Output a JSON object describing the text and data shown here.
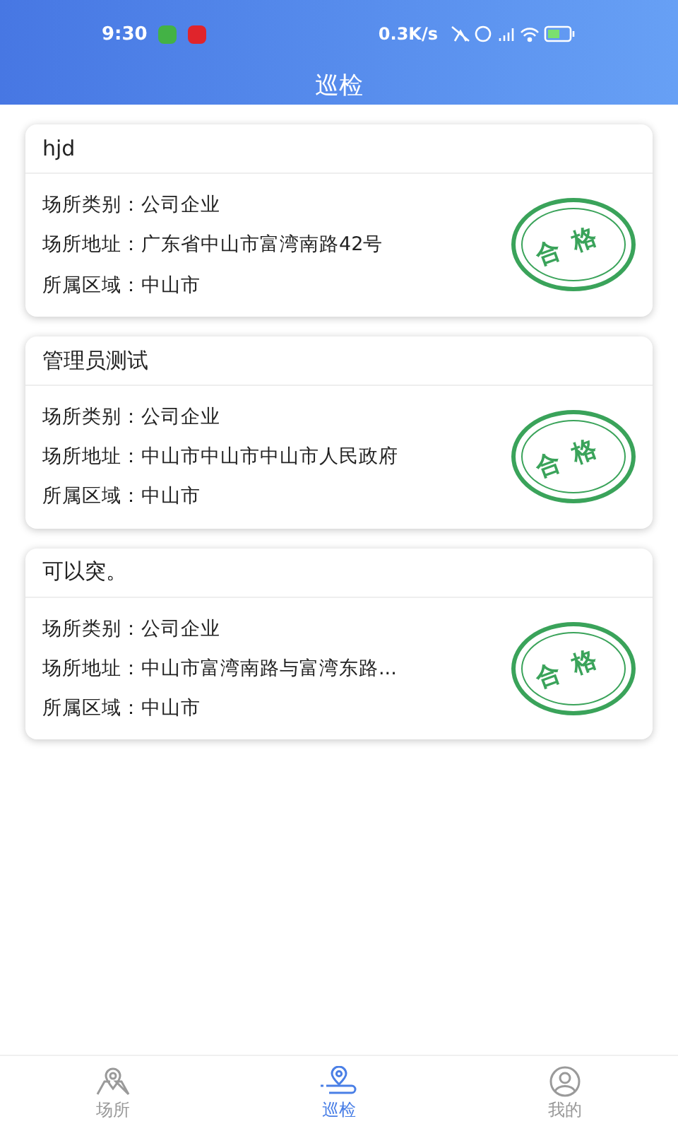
{
  "status_bar": {
    "time": "9:30",
    "net_speed": "0.3K/s"
  },
  "header": {
    "title": "巡检"
  },
  "cards": [
    {
      "title": "hjd",
      "rows": [
        {
          "label": "场所类别：",
          "value": "公司企业"
        },
        {
          "label": "场所地址：",
          "value": "广东省中山市富湾南路42号"
        },
        {
          "label": "所属区域：",
          "value": "中山市"
        }
      ],
      "stamp": "合格"
    },
    {
      "title": "管理员测试",
      "rows": [
        {
          "label": "场所类别：",
          "value": "公司企业"
        },
        {
          "label": "场所地址：",
          "value": "中山市中山市中山市人民政府"
        },
        {
          "label": "所属区域：",
          "value": "中山市"
        }
      ],
      "stamp": "合格"
    },
    {
      "title": "可以突。",
      "rows": [
        {
          "label": "场所类别：",
          "value": "公司企业"
        },
        {
          "label": "场所地址：",
          "value": "中山市富湾南路与富湾东路..."
        },
        {
          "label": "所属区域：",
          "value": "中山市"
        }
      ],
      "stamp": "合格"
    }
  ],
  "nav": [
    {
      "label": "场所",
      "kind": "map",
      "selected": false
    },
    {
      "label": "巡检",
      "kind": "route",
      "selected": true
    },
    {
      "label": "我的",
      "kind": "user",
      "selected": false
    }
  ]
}
